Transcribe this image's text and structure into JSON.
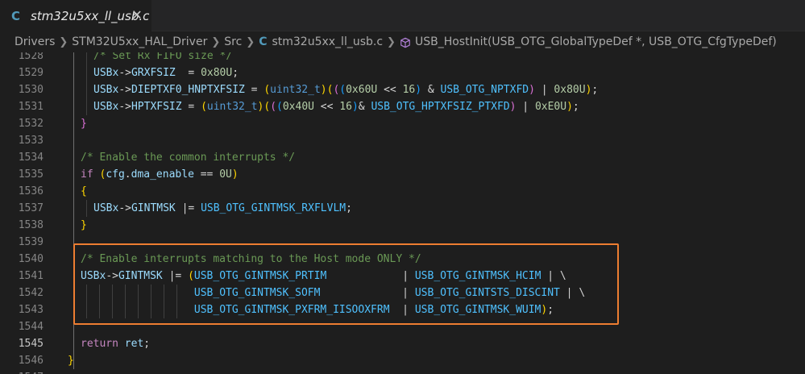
{
  "tab": {
    "lang_icon": "C",
    "title": "stm32u5xx_ll_usb.c",
    "close_icon": "close-icon"
  },
  "breadcrumb": {
    "items": [
      "Drivers",
      "STM32U5xx_HAL_Driver",
      "Src",
      "stm32u5xx_ll_usb.c",
      "USB_HostInit(USB_OTG_GlobalTypeDef *, USB_OTG_CfgTypeDef)"
    ],
    "file_icon": "C",
    "symbol_icon": "method-icon"
  },
  "editor": {
    "active_line": "1545",
    "highlight_color": "#ed7d31",
    "lines": [
      {
        "n": "1528",
        "t": [
          [
            "cmt",
            "/* Set Rx FIFO size */"
          ]
        ]
      },
      {
        "n": "1529",
        "t": [
          [
            "var",
            "USBx"
          ],
          [
            "p",
            "->"
          ],
          [
            "var",
            "GRXFSIZ"
          ],
          [
            "p",
            "  = "
          ],
          [
            "num",
            "0x80U"
          ],
          [
            "p",
            ";"
          ]
        ]
      },
      {
        "n": "1530",
        "t": [
          [
            "var",
            "USBx"
          ],
          [
            "p",
            "->"
          ],
          [
            "var",
            "DIEPTXF0_HNPTXFSIZ"
          ],
          [
            "p",
            " = "
          ],
          [
            "y",
            "("
          ],
          [
            "type",
            "uint32_t"
          ],
          [
            "y",
            ")"
          ],
          [
            "y",
            "("
          ],
          [
            "pk",
            "("
          ],
          [
            "bl",
            "("
          ],
          [
            "num",
            "0x60U"
          ],
          [
            "p",
            " << "
          ],
          [
            "num",
            "16"
          ],
          [
            "bl",
            ")"
          ],
          [
            "p",
            " & "
          ],
          [
            "mac",
            "USB_OTG_NPTXFD"
          ],
          [
            "pk",
            ")"
          ],
          [
            "p",
            " | "
          ],
          [
            "num",
            "0x80U"
          ],
          [
            "y",
            ")"
          ],
          [
            "p",
            ";"
          ]
        ]
      },
      {
        "n": "1531",
        "t": [
          [
            "var",
            "USBx"
          ],
          [
            "p",
            "->"
          ],
          [
            "var",
            "HPTXFSIZ"
          ],
          [
            "p",
            " = "
          ],
          [
            "y",
            "("
          ],
          [
            "type",
            "uint32_t"
          ],
          [
            "y",
            ")"
          ],
          [
            "y",
            "("
          ],
          [
            "pk",
            "("
          ],
          [
            "bl",
            "("
          ],
          [
            "num",
            "0x40U"
          ],
          [
            "p",
            " << "
          ],
          [
            "num",
            "16"
          ],
          [
            "bl",
            ")"
          ],
          [
            "p",
            "& "
          ],
          [
            "mac",
            "USB_OTG_HPTXFSIZ_PTXFD"
          ],
          [
            "pk",
            ")"
          ],
          [
            "p",
            " | "
          ],
          [
            "num",
            "0xE0U"
          ],
          [
            "y",
            ")"
          ],
          [
            "p",
            ";"
          ]
        ]
      },
      {
        "n": "1532",
        "t": [
          [
            "pk",
            "}"
          ]
        ]
      },
      {
        "n": "1533",
        "t": []
      },
      {
        "n": "1534",
        "t": [
          [
            "cmt",
            "/* Enable the common interrupts */"
          ]
        ]
      },
      {
        "n": "1535",
        "t": [
          [
            "kw",
            "if"
          ],
          [
            "p",
            " "
          ],
          [
            "y",
            "("
          ],
          [
            "var",
            "cfg"
          ],
          [
            "p",
            "."
          ],
          [
            "var",
            "dma_enable"
          ],
          [
            "p",
            " == "
          ],
          [
            "num",
            "0U"
          ],
          [
            "y",
            ")"
          ]
        ]
      },
      {
        "n": "1536",
        "t": [
          [
            "y",
            "{"
          ]
        ]
      },
      {
        "n": "1537",
        "t": [
          [
            "var",
            "USBx"
          ],
          [
            "p",
            "->"
          ],
          [
            "var",
            "GINTMSK"
          ],
          [
            "p",
            " |= "
          ],
          [
            "mac",
            "USB_OTG_GINTMSK_RXFLVLM"
          ],
          [
            "p",
            ";"
          ]
        ]
      },
      {
        "n": "1538",
        "t": [
          [
            "y",
            "}"
          ]
        ]
      },
      {
        "n": "1539",
        "t": []
      },
      {
        "n": "1540",
        "t": [
          [
            "cmt",
            "/* Enable interrupts matching to the Host mode ONLY */"
          ]
        ]
      },
      {
        "n": "1541",
        "t": [
          [
            "var",
            "USBx"
          ],
          [
            "p",
            "->"
          ],
          [
            "var",
            "GINTMSK"
          ],
          [
            "p",
            " |= "
          ],
          [
            "y",
            "("
          ],
          [
            "mac",
            "USB_OTG_GINTMSK_PRTIM"
          ],
          [
            "p",
            "            | "
          ],
          [
            "mac",
            "USB_OTG_GINTMSK_HCIM"
          ],
          [
            "p",
            " | \\"
          ]
        ]
      },
      {
        "n": "1542",
        "t": [
          [
            "p",
            "                  "
          ],
          [
            "mac",
            "USB_OTG_GINTMSK_SOFM"
          ],
          [
            "p",
            "             | "
          ],
          [
            "mac",
            "USB_OTG_GINTSTS_DISCINT"
          ],
          [
            "p",
            " | \\"
          ]
        ]
      },
      {
        "n": "1543",
        "t": [
          [
            "p",
            "                  "
          ],
          [
            "mac",
            "USB_OTG_GINTMSK_PXFRM_IISOOXFRM"
          ],
          [
            "p",
            "  | "
          ],
          [
            "mac",
            "USB_OTG_GINTMSK_WUIM"
          ],
          [
            "y",
            ")"
          ],
          [
            "p",
            ";"
          ]
        ]
      },
      {
        "n": "1544",
        "t": []
      },
      {
        "n": "1545",
        "t": [
          [
            "kw",
            "return"
          ],
          [
            "p",
            " "
          ],
          [
            "var",
            "ret"
          ],
          [
            "p",
            ";"
          ]
        ]
      },
      {
        "n": "1546",
        "t": [
          [
            "y",
            "}"
          ]
        ]
      },
      {
        "n": "1547",
        "t": []
      }
    ]
  }
}
